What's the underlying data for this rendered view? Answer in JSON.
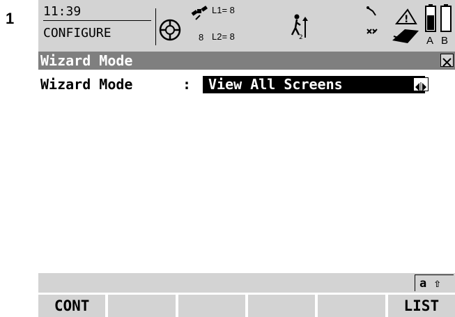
{
  "step_number": "1",
  "status_bar": {
    "time": "11:39",
    "mode": "CONFIGURE",
    "satellites_visible": "8",
    "l1_label": "L1= 8",
    "l2_label": "L2= 8",
    "battery_a_label": "A",
    "battery_b_label": "B"
  },
  "title_bar": {
    "title": "Wizard Mode",
    "close_icon": "close-icon"
  },
  "form": {
    "field_label": "Wizard Mode",
    "colon": ":",
    "field_value": "View All Screens",
    "arrows_icon": "left-right-arrows-icon"
  },
  "input_mode": {
    "indicator": "a ⇧"
  },
  "softkeys": [
    "CONT",
    "",
    "",
    "",
    "",
    "LIST"
  ],
  "colors": {
    "status_bg": "#d3d3d3",
    "title_bg": "#7f7f7f",
    "selected_bg": "#000000"
  }
}
